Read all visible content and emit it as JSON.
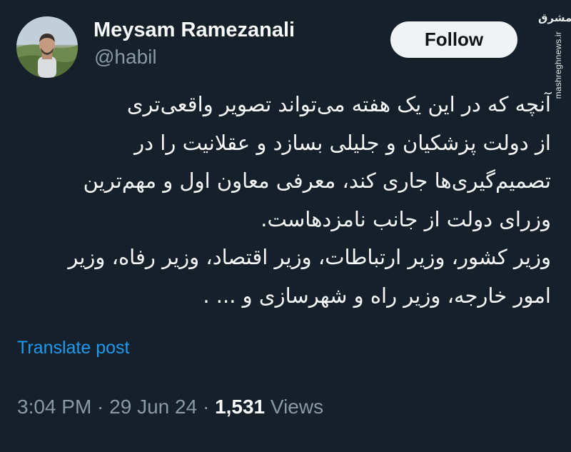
{
  "author": {
    "display_name": "Meysam Ramezanali",
    "handle": "@habil",
    "avatar_icon": "profile-photo"
  },
  "follow_button": {
    "label": "Follow"
  },
  "watermark": {
    "logo_text": "مشرق",
    "site": "mashreghnews.ir"
  },
  "tweet": {
    "lines": [
      "آنچه که در این یک هفته می‌تواند تصویر واقعی‌تری",
      "از دولت پزشکیان و جلیلی بسازد و عقلانیت را در",
      "تصمیم‌گیری‌ها جاری کند، معرفی معاون اول و مهم‌ترین",
      "وزرای دولت از جانب نامزدهاست.",
      "وزیر کشور، وزیر ارتباطات، وزیر اقتصاد، وزیر رفاه، وزیر",
      "امور خارجه، وزیر راه و شهرسازی و ... ."
    ]
  },
  "translate_label": "Translate post",
  "meta": {
    "time": "3:04 PM",
    "separator": " · ",
    "date": "29 Jun 24",
    "views_count": "1,531",
    "views_label": " Views"
  },
  "colors": {
    "background": "#15202b",
    "text_primary": "#f7f9f9",
    "text_secondary": "#8b98a5",
    "link": "#1d9bf0",
    "button_bg": "#eff3f4"
  }
}
